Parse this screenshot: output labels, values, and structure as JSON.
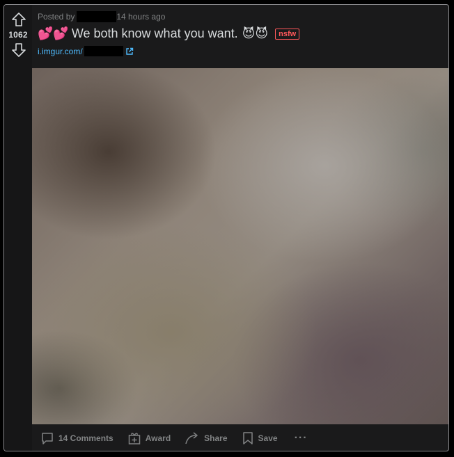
{
  "post": {
    "score": "1062",
    "posted_by_label": "Posted by",
    "time_ago": "14 hours ago",
    "title_emoji_prefix": "💕💕",
    "title": "We both know what you want.",
    "title_emoji_suffix": "😈😈",
    "nsfw_badge": "nsfw",
    "link_domain": "i.imgur.com/"
  },
  "actions": {
    "comments_label": "14 Comments",
    "award_label": "Award",
    "share_label": "Share",
    "save_label": "Save",
    "more_label": "···"
  },
  "colors": {
    "background": "#000000",
    "card": "#1a1a1b",
    "text": "#d7dadc",
    "muted": "#818384",
    "link": "#4fbcff",
    "nsfw": "#ff585b"
  },
  "icons": {
    "upvote": "arrow-up-icon",
    "downvote": "arrow-down-icon",
    "external_link": "external-link-icon",
    "comments": "comment-bubble-icon",
    "award": "gift-icon",
    "share": "share-arrow-icon",
    "save": "bookmark-icon"
  }
}
